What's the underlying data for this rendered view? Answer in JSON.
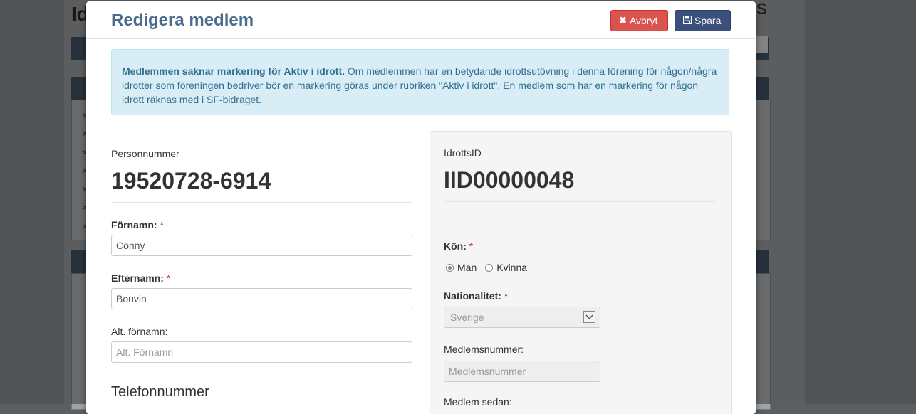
{
  "background": {
    "title": "Id",
    "title_right": "S",
    "bullets": [
      "×",
      "×",
      "×",
      "×",
      "×",
      "×",
      "×"
    ]
  },
  "modal": {
    "title": "Redigera medlem",
    "cancel_label": "Avbryt",
    "save_label": "Spara",
    "alert": {
      "bold": "Medlemmen saknar markering för Aktiv i idrott.",
      "text": " Om medlemmen har en betydande idrottsutövning i denna förening för någon/några idrotter som föreningen bedriver bör en markering göras under rubriken \"Aktiv i idrott\". En medlem som har en markering för någon idrott räknas med i SF-bidraget."
    },
    "left": {
      "personnummer_label": "Personnummer",
      "personnummer_value": "19520728-6914",
      "fornamn_label": "Förnamn:",
      "fornamn_value": "Conny",
      "efternamn_label": "Efternamn:",
      "efternamn_value": "Bouvin",
      "alt_fornamn_label": "Alt. förnamn:",
      "alt_fornamn_placeholder": "Alt. Förnamn",
      "telefon_heading": "Telefonnummer"
    },
    "right": {
      "idrottsid_label": "IdrottsID",
      "idrottsid_value": "IID00000048",
      "kon_label": "Kön:",
      "kon_options": [
        "Man",
        "Kvinna"
      ],
      "kon_selected": "Man",
      "nationalitet_label": "Nationalitet:",
      "nationalitet_value": "Sverige",
      "medlemsnummer_label": "Medlemsnummer:",
      "medlemsnummer_placeholder": "Medlemsnummer",
      "medlem_sedan_label": "Medlem sedan:"
    },
    "required_marker": "*"
  },
  "colors": {
    "title": "#4a6a8e",
    "cancel": "#d9534f",
    "save": "#3a4f7a",
    "alert_bg": "#d9edf7",
    "alert_text": "#31708f",
    "required": "#c0392b"
  },
  "icons": {
    "cancel": "close-icon",
    "save": "save-icon",
    "select": "chevron-down-icon"
  }
}
